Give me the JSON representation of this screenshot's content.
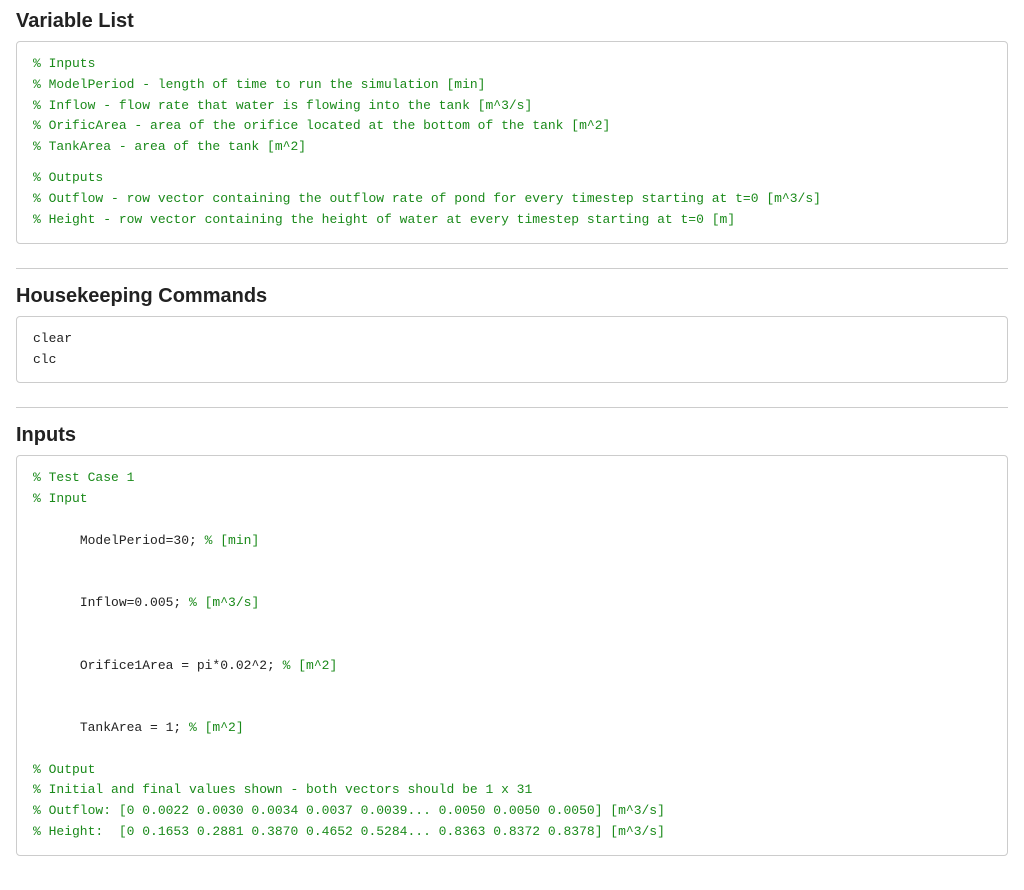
{
  "variableList": {
    "title": "Variable List",
    "lines": [
      {
        "type": "comment",
        "text": "% Inputs"
      },
      {
        "type": "comment",
        "text": "% ModelPeriod - length of time to run the simulation [min]"
      },
      {
        "type": "comment",
        "text": "% Inflow - flow rate that water is flowing into the tank [m^3/s]"
      },
      {
        "type": "comment",
        "text": "% OrificArea - area of the orifice located at the bottom of the tank [m^2]"
      },
      {
        "type": "comment",
        "text": "% TankArea - area of the tank [m^2]"
      },
      {
        "type": "blank"
      },
      {
        "type": "comment",
        "text": "% Outputs"
      },
      {
        "type": "comment",
        "text": "% Outflow - row vector containing the outflow rate of pond for every timestep starting at t=0 [m^3/s]"
      },
      {
        "type": "comment",
        "text": "% Height - row vector containing the height of water at every timestep starting at t=0 [m]"
      }
    ]
  },
  "housekeeping": {
    "title": "Housekeeping Commands",
    "lines": [
      {
        "type": "code",
        "text": "clear"
      },
      {
        "type": "code",
        "text": "clc"
      }
    ]
  },
  "inputs": {
    "title": "Inputs",
    "lines": [
      {
        "type": "comment",
        "text": "% Test Case 1"
      },
      {
        "type": "comment",
        "text": "% Input"
      },
      {
        "type": "mixed",
        "parts": [
          {
            "type": "code",
            "text": "ModelPeriod=30; "
          },
          {
            "type": "comment",
            "text": "% [min]"
          }
        ]
      },
      {
        "type": "mixed",
        "parts": [
          {
            "type": "code",
            "text": "Inflow=0.005; "
          },
          {
            "type": "comment",
            "text": "% [m^3/s]"
          }
        ]
      },
      {
        "type": "mixed",
        "parts": [
          {
            "type": "code",
            "text": "Orifice1Area = pi*0.02^2; "
          },
          {
            "type": "comment",
            "text": "% [m^2]"
          }
        ]
      },
      {
        "type": "mixed",
        "parts": [
          {
            "type": "code",
            "text": "TankArea = 1; "
          },
          {
            "type": "comment",
            "text": "% [m^2]"
          }
        ]
      },
      {
        "type": "comment",
        "text": "% Output"
      },
      {
        "type": "comment",
        "text": "% Initial and final values shown - both vectors should be 1 x 31"
      },
      {
        "type": "comment",
        "text": "% Outflow: [0 0.0022 0.0030 0.0034 0.0037 0.0039... 0.0050 0.0050 0.0050] [m^3/s]"
      },
      {
        "type": "comment",
        "text": "% Height:  [0 0.1653 0.2881 0.3870 0.4652 0.5284... 0.8363 0.8372 0.8378] [m^3/s]"
      }
    ]
  }
}
